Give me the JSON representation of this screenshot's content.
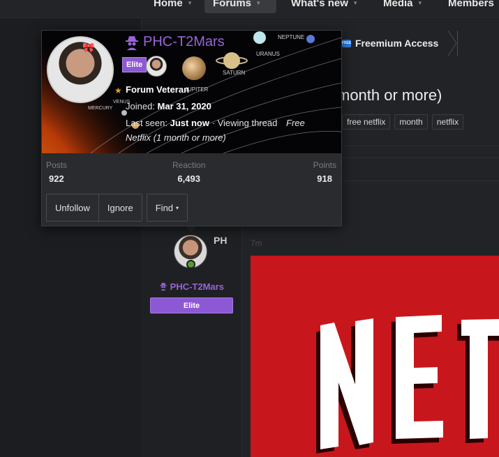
{
  "nav": {
    "items": [
      {
        "label": "Home",
        "caret": "▾",
        "active": false
      },
      {
        "label": "Forums",
        "caret": "▾",
        "active": true
      },
      {
        "label": "What's new",
        "caret": "▾",
        "active": false
      },
      {
        "label": "Media",
        "caret": "▾",
        "active": false
      },
      {
        "label": "Members",
        "caret": "",
        "active": false
      }
    ]
  },
  "breadcrumb": {
    "icon_text": "FREE",
    "label": "Freemium Access"
  },
  "thread": {
    "title_fragment": "month or more)",
    "tags": [
      "free netflix",
      "month",
      "netflix"
    ]
  },
  "post": {
    "initials": "PH",
    "username": "PHC-T2Mars",
    "badge": "Elite",
    "time": "7m"
  },
  "member_card": {
    "username": "PHC-T2Mars",
    "badge": "Elite",
    "title": "Forum Veteran",
    "joined_label": "Joined:",
    "joined_value": "Mar 31, 2020",
    "last_seen_label": "Last seen:",
    "last_seen_value": "Just now",
    "activity_sep": "·",
    "activity_label": "Viewing thread",
    "activity_thread": "Free Netflix (1 month or more)",
    "stats": [
      {
        "label": "Posts",
        "value": "922"
      },
      {
        "label": "Reaction",
        "value": "6,493"
      },
      {
        "label": "Points",
        "value": "918"
      }
    ],
    "buttons": {
      "unfollow": "Unfollow",
      "ignore": "Ignore",
      "find": "Find",
      "find_caret": "▾"
    },
    "banner_labels": {
      "neptune": "NEPTUNE",
      "uranus": "URANUS",
      "saturn": "SATURN",
      "jupiter": "JUPITER",
      "mercury": "MERCURY",
      "venus": "VENUS"
    }
  },
  "colors": {
    "accent_purple": "#9a63d8",
    "badge_purple": "#8d58d4",
    "netflix_red": "#c8171c",
    "online_green": "#5a9b2f"
  },
  "icons": {
    "breadcrumb": "free-badge-icon",
    "username": "spy-icon",
    "title": "trophy-icon",
    "online": "user-online-icon"
  }
}
